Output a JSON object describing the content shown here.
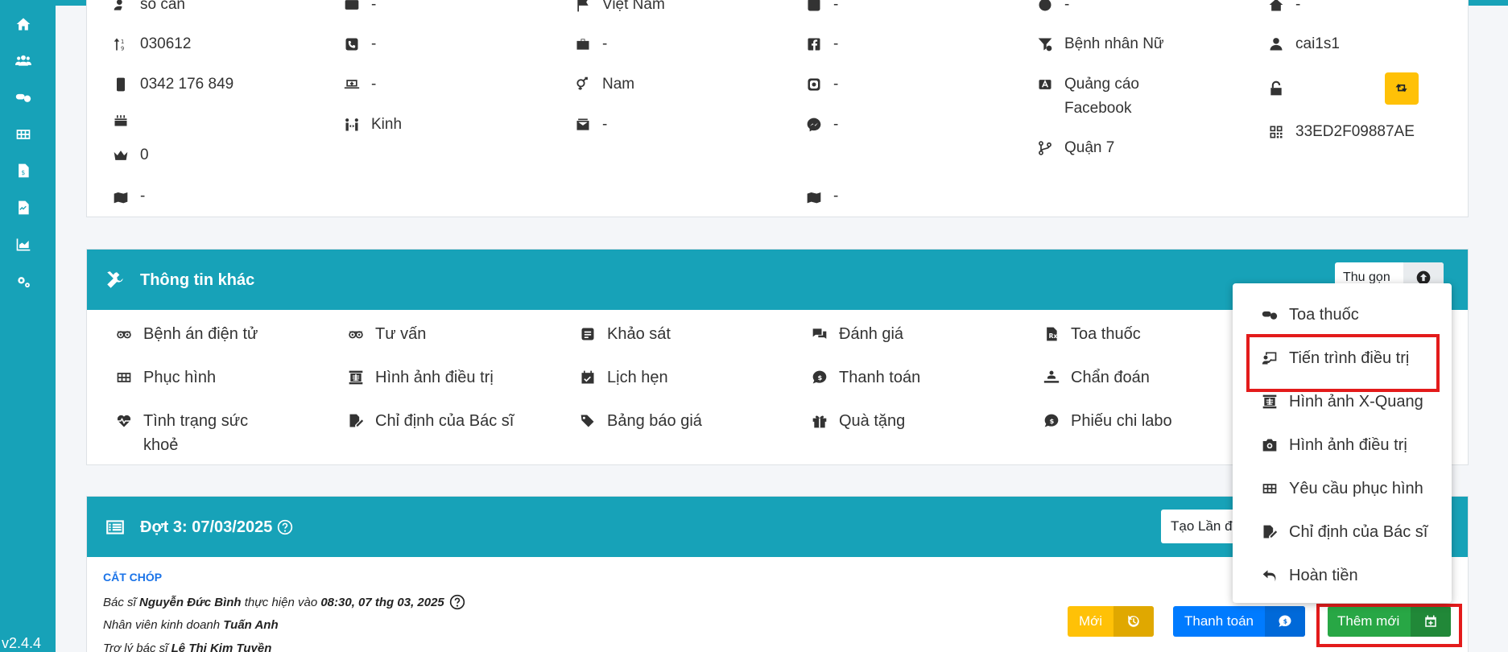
{
  "version": "v2.4.4",
  "colors": {
    "primary": "#17a2b8",
    "warning": "#ffc107",
    "blue": "#007bff",
    "success": "#28a745",
    "highlight": "#e31b1b"
  },
  "sidebar_icons": [
    "home-icon",
    "users-icon",
    "pills-icon",
    "grid-icon",
    "invoice-icon",
    "report-icon",
    "chart-icon",
    "settings-icon"
  ],
  "patient_info": {
    "so_can": "số căn",
    "code": "030612",
    "phone": "0342 176 849",
    "birthday": "",
    "rank": "0",
    "address": "-",
    "col2_top": "-",
    "col2_phone2": "-",
    "col2_monitor": "-",
    "ethnicity": "Kinh",
    "country": "Việt Nam",
    "job": "-",
    "gender": "Nam",
    "email": "-",
    "col4_top": "-",
    "facebook": "-",
    "instagram": "-",
    "messenger": "-",
    "col4_map": "-",
    "col5_top": "-",
    "group": "Bệnh nhân Nữ",
    "source": "Quảng cáo Facebook",
    "branch": "Quận 7",
    "col6_top": "-",
    "username": "cai1s1",
    "qr_code": "33ED2F09887AE"
  },
  "other_info": {
    "title": "Thông tin khác",
    "collapse_label": "Thu gọn",
    "items": [
      "Bệnh án điện tử",
      "Tư vấn",
      "Khảo sát",
      "Đánh giá",
      "Toa thuốc",
      "Phục hình",
      "Hình ảnh điều trị",
      "Lịch hẹn",
      "Thanh toán",
      "Chẩn đoán",
      "Tình trạng sức khoẻ",
      "Chỉ định của Bác sĩ",
      "Bảng báo giá",
      "Quà tặng",
      "Phiếu chi labo"
    ]
  },
  "session": {
    "title": "Đợt 3: 07/03/2025",
    "create_btn": "Tạo Lần điều trị",
    "procedure_title": "CẮT CHÓP",
    "doctor_prefix": "Bác sĩ",
    "doctor": "Nguyễn Đức Bình",
    "doctor_mid": "thực hiện vào",
    "doctor_time": "08:30, 07 thg 03, 2025",
    "sales_prefix": "Nhân viên kinh doanh",
    "sales": "Tuấn Anh",
    "assistant_prefix": "Trợ lý bác sĩ",
    "assistant": "Lê Thị Kim Tuyền",
    "btn_new": "Mới",
    "btn_pay": "Thanh toán",
    "btn_add": "Thêm mới"
  },
  "dropdown": {
    "items": [
      "Toa thuốc",
      "Tiến trình điều trị",
      "Hình ảnh X-Quang",
      "Hình ảnh điều trị",
      "Yêu cầu phục hình",
      "Chỉ định của Bác sĩ",
      "Hoàn tiền"
    ]
  }
}
